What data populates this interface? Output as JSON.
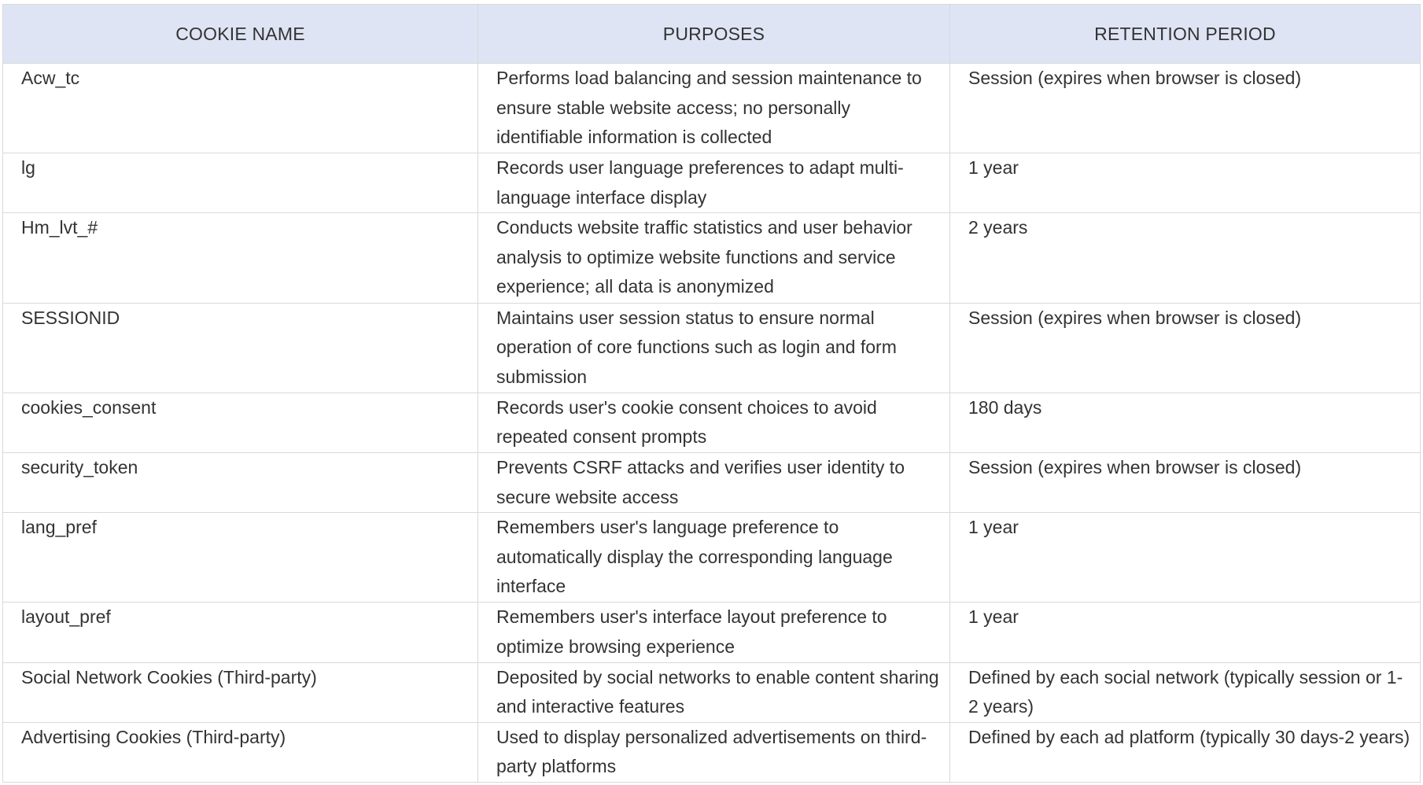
{
  "table": {
    "headers": [
      "COOKIE NAME",
      "PURPOSES",
      "RETENTION PERIOD"
    ],
    "rows": [
      {
        "name": "Acw_tc",
        "purpose": "Performs load balancing and session maintenance to ensure stable website access; no personally identifiable information is collected",
        "retention": "Session (expires when browser is closed)"
      },
      {
        "name": "lg",
        "purpose": "Records user language preferences to adapt multi-language interface display",
        "retention": "1 year"
      },
      {
        "name": "Hm_lvt_#",
        "purpose": "Conducts website traffic statistics and user behavior analysis to optimize website functions and service experience; all data is anonymized",
        "retention": "2 years"
      },
      {
        "name": "SESSIONID",
        "purpose": "Maintains user session status to ensure normal operation of core functions such as login and form submission",
        "retention": "Session (expires when browser is closed)"
      },
      {
        "name": "cookies_consent",
        "purpose": "Records user's cookie consent choices to avoid repeated consent prompts",
        "retention": "180 days"
      },
      {
        "name": "security_token",
        "purpose": "Prevents CSRF attacks and verifies user identity to secure website access",
        "retention": "Session (expires when browser is closed)"
      },
      {
        "name": "lang_pref",
        "purpose": "Remembers user's language preference to automatically display the corresponding language interface",
        "retention": "1 year"
      },
      {
        "name": "layout_pref",
        "purpose": "Remembers user's interface layout preference to optimize browsing experience",
        "retention": "1 year"
      },
      {
        "name": "Social Network Cookies (Third-party)",
        "purpose": "Deposited by social networks to enable content sharing and interactive features",
        "retention": "Defined by each social network (typically session or 1-2 years)"
      },
      {
        "name": "Advertising Cookies (Third-party)",
        "purpose": "Used to display personalized advertisements on third-party platforms",
        "retention": "Defined by each ad platform (typically 30 days-2 years)"
      }
    ]
  }
}
